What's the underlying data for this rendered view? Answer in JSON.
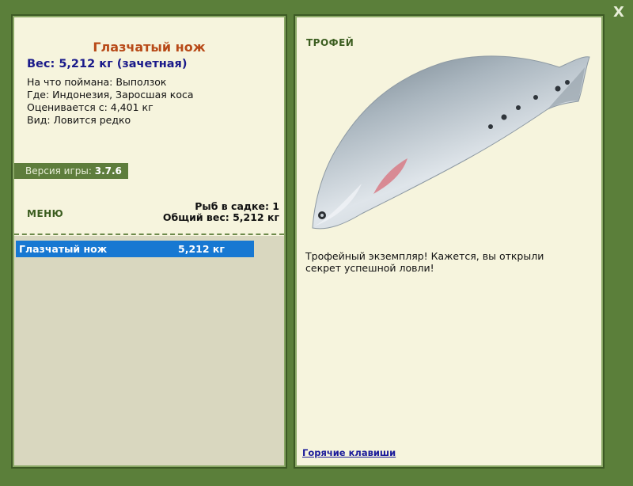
{
  "fish": {
    "name": "Глазчатый нож",
    "weight_line": "Вес: 5,212 кг (зачетная)",
    "bait": "На что поймана: Выползок",
    "location": "Где: Индонезия, Заросшая коса",
    "valued_from": "Оценивается с: 4,401 кг",
    "rarity": "Вид: Ловится редко"
  },
  "version": {
    "label": "Версия игры:",
    "value": "3.7.6"
  },
  "menu": {
    "label": "МЕНЮ"
  },
  "keepnet": {
    "count_line": "Рыб в садке: 1",
    "total_line": "Общий вес: 5,212 кг",
    "items": [
      {
        "name": "Глазчатый нож",
        "weight": "5,212 кг"
      }
    ]
  },
  "trophy": {
    "label": "ТРОФЕЙ",
    "text": "Трофейный экземпляр! Кажется, вы открыли секрет успешной ловли!"
  },
  "links": {
    "hotkeys": "Горячие клавиши"
  },
  "controls": {
    "close": "X"
  },
  "colors": {
    "background": "#5b7f3a",
    "panel": "#f6f4dd",
    "title": "#b84a18",
    "weight": "#1a1a8a",
    "selected_row": "#1778d2"
  }
}
